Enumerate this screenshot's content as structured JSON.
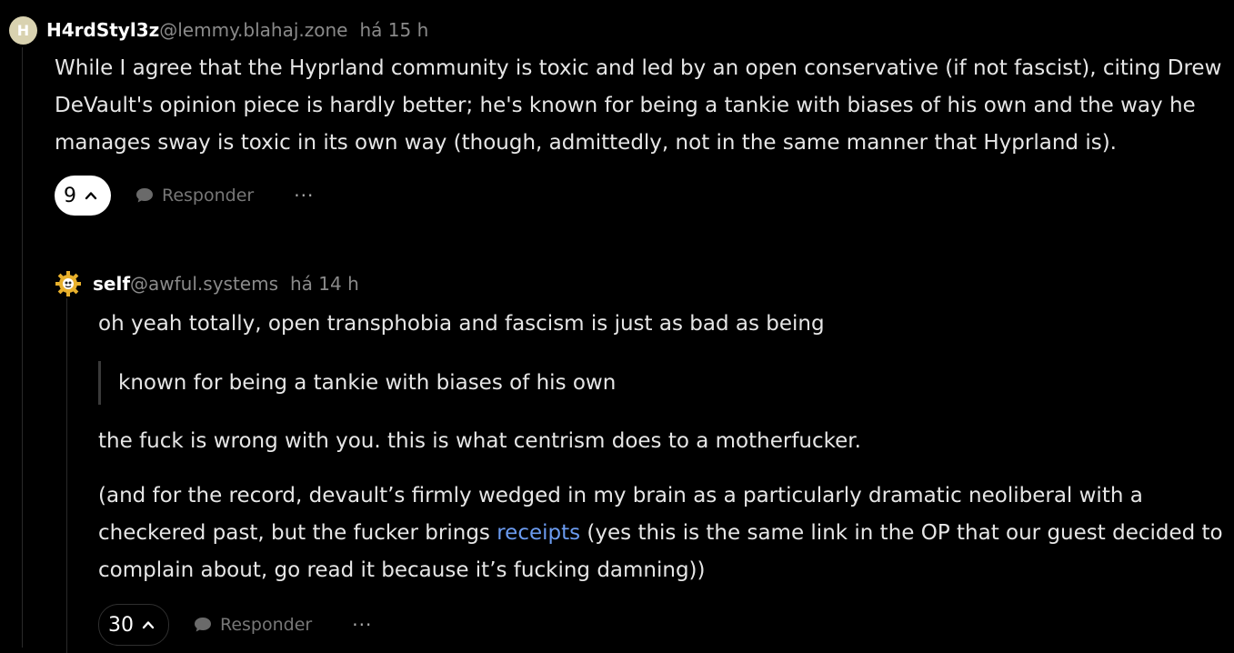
{
  "comments": [
    {
      "avatar_letter": "H",
      "username": "H4rdStyl3z",
      "instance": "@lemmy.blahaj.zone",
      "time": "há 15 h",
      "body": [
        "While I agree that the Hyprland community is toxic and led by an open conservative (if not fascist), citing Drew DeVault's opinion piece is hardly better; he's known for being a tankie with biases of his own and the way he manages sway is toxic in its own way (though, admittedly, not in the same manner that Hyprland is)."
      ],
      "score": "9",
      "reply_label": "Responder",
      "more_label": "···"
    },
    {
      "avatar_icon": "gear-avatar",
      "username": "self",
      "instance": "@awful.systems",
      "time": "há 14 h",
      "paragraph1": "oh yeah totally, open transphobia and fascism is just as bad as being",
      "quote": "known for being a tankie with biases of his own",
      "paragraph2": "the fuck is wrong with you. this is what centrism does to a motherfucker.",
      "paragraph3_before": "(and for the record, devault’s firmly wedged in my brain as a particularly dramatic neoliberal with a checkered past, but the fucker brings ",
      "paragraph3_link": "receipts",
      "paragraph3_after": " (yes this is the same link in the OP that our guest decided to complain about, go read it because it’s fucking damning))",
      "score": "30",
      "reply_label": "Responder",
      "more_label": "···"
    }
  ],
  "colors": {
    "background": "#000000",
    "link": "#6b9bf0",
    "muted": "#8a8a8a"
  }
}
